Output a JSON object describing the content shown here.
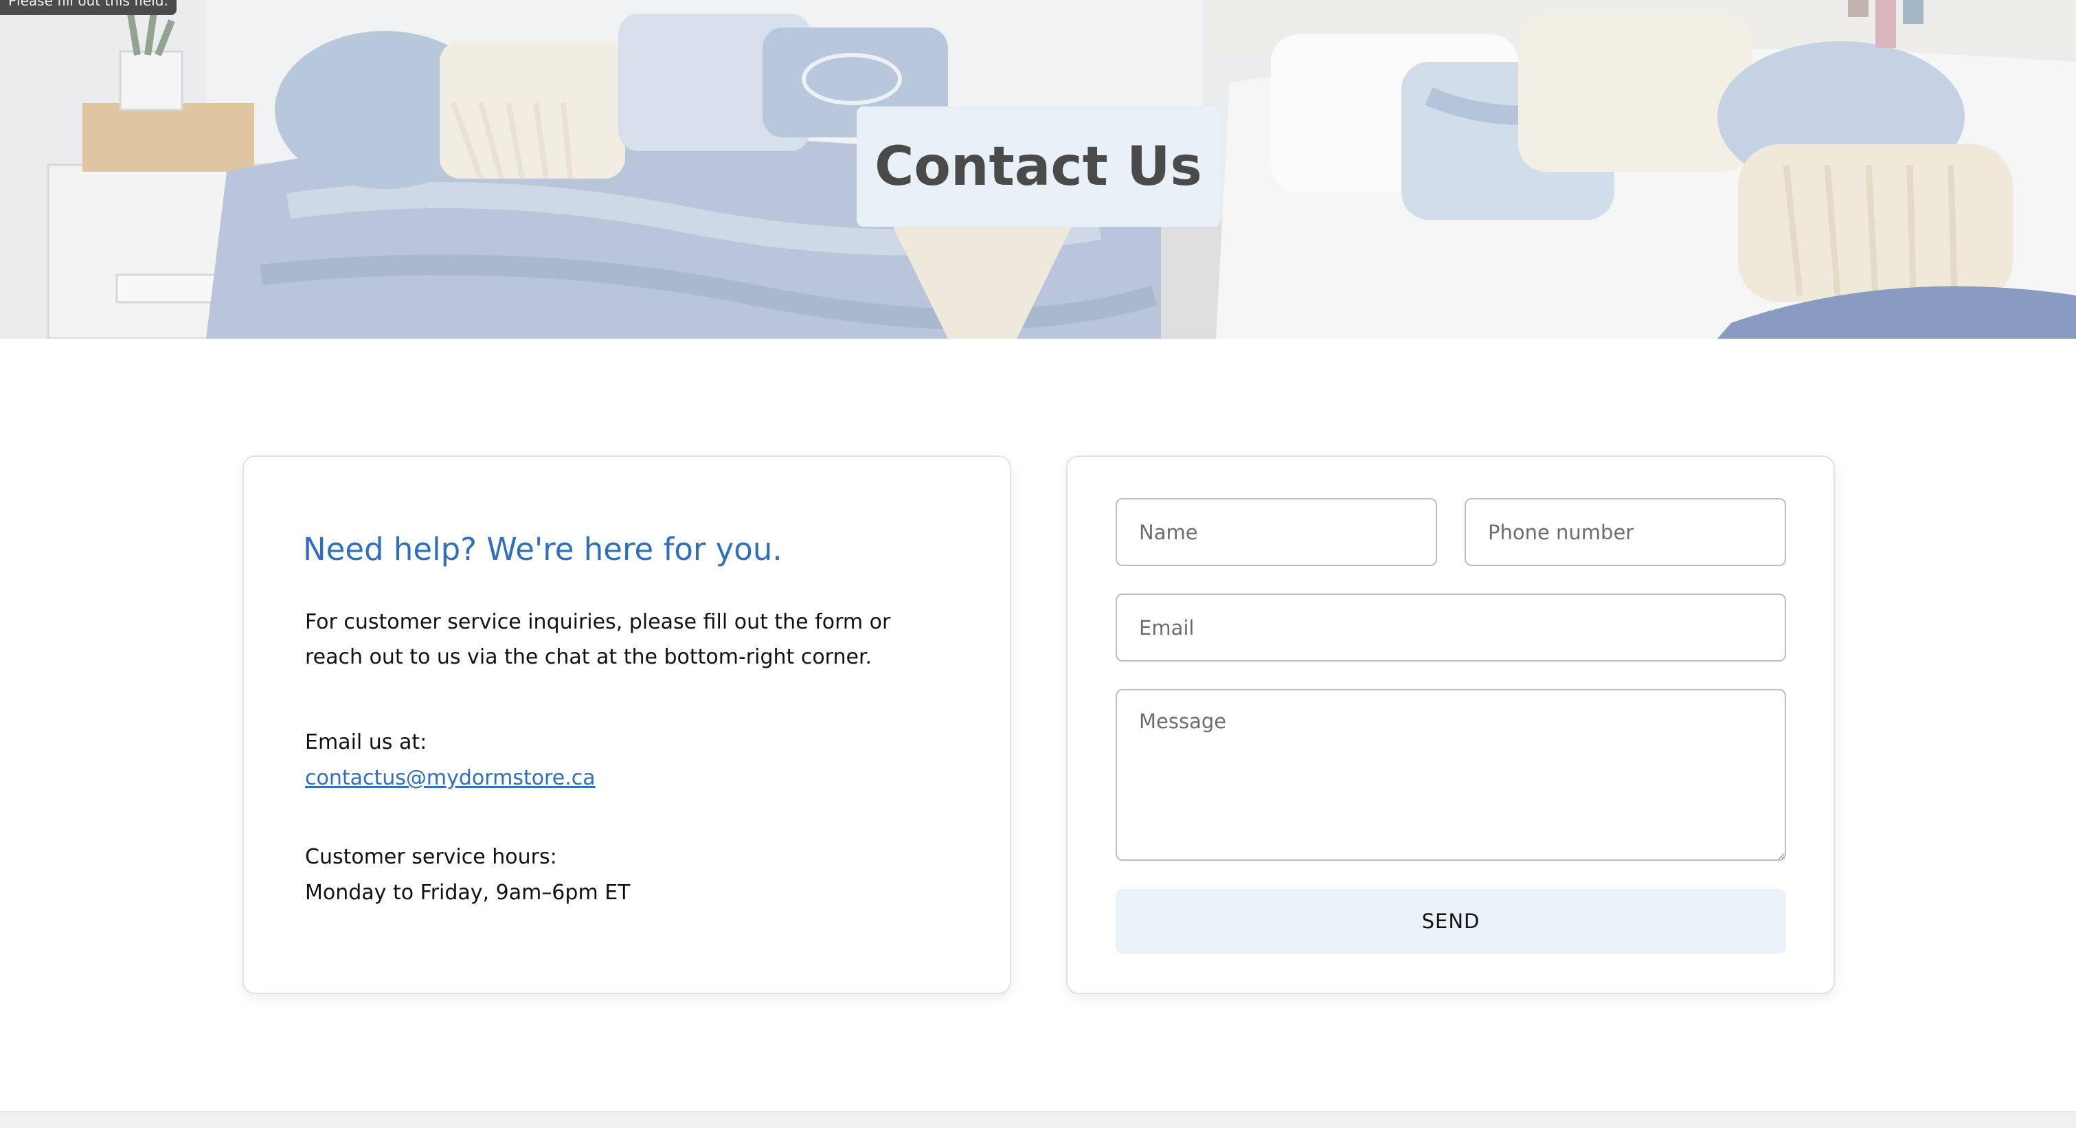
{
  "tooltip": "Please fill out this field.",
  "hero": {
    "title": "Contact Us"
  },
  "info": {
    "heading": "Need help? We're here for you.",
    "description": "For customer service inquiries, please fill out the form or reach out to us via the chat at the bottom-right corner.",
    "email_label": "Email us at:",
    "email": "contactus@mydormstore.ca",
    "hours_label": "Customer service hours:",
    "hours": "Monday to Friday, 9am–6pm ET"
  },
  "form": {
    "name_placeholder": "Name",
    "phone_placeholder": "Phone number",
    "email_placeholder": "Email",
    "message_placeholder": "Message",
    "send_label": "SEND"
  },
  "colors": {
    "accent": "#2f6fbf",
    "title_box": "#e9f1f8",
    "button": "#e9f2f9"
  }
}
